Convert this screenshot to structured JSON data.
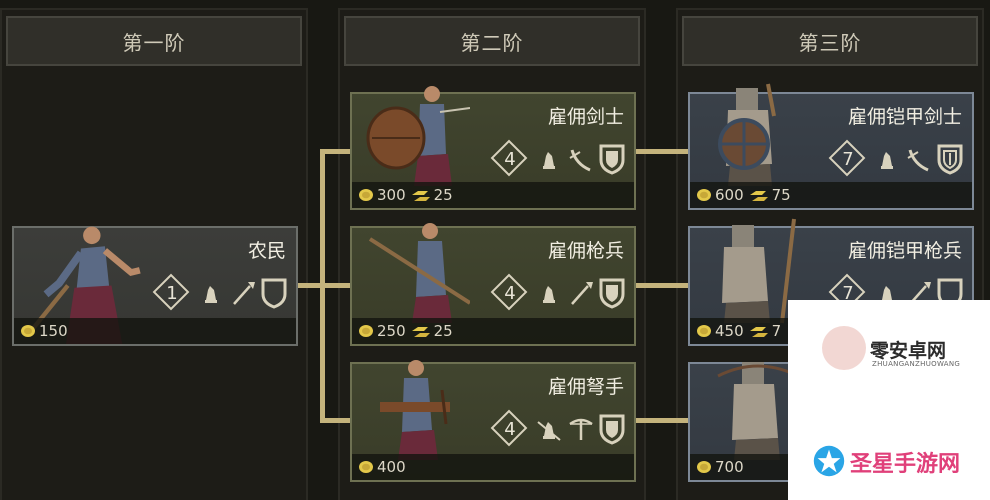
{
  "columns": [
    {
      "header": "第一阶"
    },
    {
      "header": "第二阶"
    },
    {
      "header": "第三阶"
    }
  ],
  "units": {
    "peasant": {
      "name": "农民",
      "tier": "1",
      "gold": "150"
    },
    "swordsman": {
      "name": "雇佣剑士",
      "tier": "4",
      "gold": "300",
      "iron": "25"
    },
    "spearman": {
      "name": "雇佣枪兵",
      "tier": "4",
      "gold": "250",
      "iron": "25"
    },
    "crossbowman": {
      "name": "雇佣弩手",
      "tier": "4",
      "gold": "400"
    },
    "armored_sword": {
      "name": "雇佣铠甲剑士",
      "tier": "7",
      "gold": "600",
      "iron": "75"
    },
    "armored_spear": {
      "name": "雇佣铠甲枪兵",
      "tier": "7",
      "gold": "450",
      "iron": "7"
    },
    "armored_xbow": {
      "gold": "700"
    }
  },
  "watermarks": {
    "top": {
      "title": "零安卓网",
      "subtitle": "ZHUANGANZHUOWANG"
    },
    "bottom": {
      "title": "圣星手游网"
    }
  },
  "colors": {
    "tier2_card": "#41452f",
    "tier3_card": "#3a4149",
    "connector": "#c4b37c",
    "gold_coin": "#e3c84a",
    "watermark_pink": "#e0407a"
  }
}
